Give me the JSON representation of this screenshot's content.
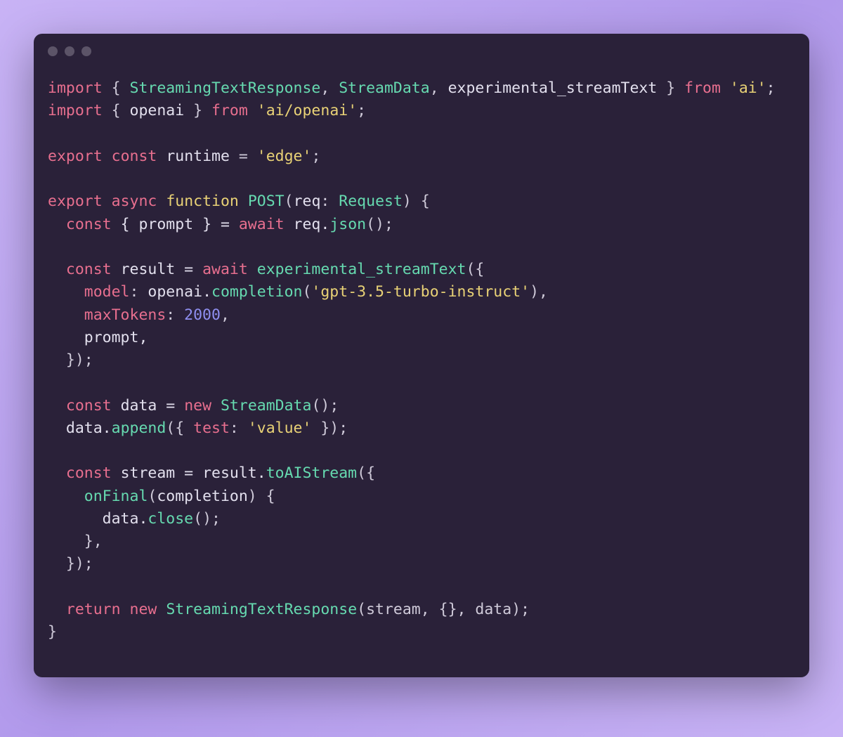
{
  "code": {
    "line1": {
      "import": "import",
      "lbrace": " { ",
      "StreamingTextResponse": "StreamingTextResponse",
      "comma1": ", ",
      "StreamData": "StreamData",
      "comma2": ", ",
      "experimental_streamText": "experimental_streamText",
      "rbrace": " } ",
      "from": "from",
      "sp": " ",
      "pkg": "'ai'",
      "semi": ";"
    },
    "line2": {
      "import": "import",
      "lbrace": " { ",
      "openai": "openai",
      "rbrace": " } ",
      "from": "from",
      "sp": " ",
      "pkg": "'ai/openai'",
      "semi": ";"
    },
    "line4": {
      "export": "export",
      "sp1": " ",
      "const": "const",
      "sp2": " ",
      "runtime": "runtime",
      "eq": " = ",
      "val": "'edge'",
      "semi": ";"
    },
    "line6": {
      "export": "export",
      "sp1": " ",
      "async": "async",
      "sp2": " ",
      "function": "function",
      "sp3": " ",
      "POST": "POST",
      "lp": "(",
      "req": "req",
      "colon": ": ",
      "Request": "Request",
      "rp": ")",
      "sp4": " ",
      "lbrace": "{"
    },
    "line7": {
      "indent": "  ",
      "const": "const",
      "sp": " ",
      "destruct": "{ prompt } = ",
      "await": "await",
      "sp2": " ",
      "req": "req.",
      "json": "json",
      "call": "();"
    },
    "line9": {
      "indent": "  ",
      "const": "const",
      "sp": " ",
      "result": "result = ",
      "await": "await",
      "sp2": " ",
      "fn": "experimental_streamText",
      "open": "({"
    },
    "line10": {
      "indent": "    ",
      "model": "model",
      "colon": ": ",
      "openai": "openai.",
      "completion": "completion",
      "lp": "(",
      "arg": "'gpt-3.5-turbo-instruct'",
      "rp": "),"
    },
    "line11": {
      "indent": "    ",
      "maxTokens": "maxTokens",
      "colon": ": ",
      "num": "2000",
      "comma": ","
    },
    "line12": {
      "indent": "    ",
      "prompt": "prompt,"
    },
    "line13": {
      "indent": "  ",
      "close": "});"
    },
    "line15": {
      "indent": "  ",
      "const": "const",
      "sp": " ",
      "data": "data = ",
      "new": "new",
      "sp2": " ",
      "StreamData": "StreamData",
      "call": "();"
    },
    "line16": {
      "indent": "  ",
      "data": "data.",
      "append": "append",
      "lp": "({ ",
      "test": "test",
      "colon": ": ",
      "val": "'value'",
      "rp": " });"
    },
    "line18": {
      "indent": "  ",
      "const": "const",
      "sp": " ",
      "stream": "stream = result.",
      "toAIStream": "toAIStream",
      "open": "({"
    },
    "line19": {
      "indent": "    ",
      "onFinal": "onFinal",
      "lp": "(",
      "completion": "completion",
      "rp": ") {"
    },
    "line20": {
      "indent": "      ",
      "data": "data.",
      "close": "close",
      "call": "();"
    },
    "line21": {
      "indent": "    ",
      "close": "},"
    },
    "line22": {
      "indent": "  ",
      "close": "});"
    },
    "line24": {
      "indent": "  ",
      "return": "return",
      "sp": " ",
      "new": "new",
      "sp2": " ",
      "StreamingTextResponse": "StreamingTextResponse",
      "args": "(stream, {}, data);"
    },
    "line25": {
      "close": "}"
    }
  }
}
